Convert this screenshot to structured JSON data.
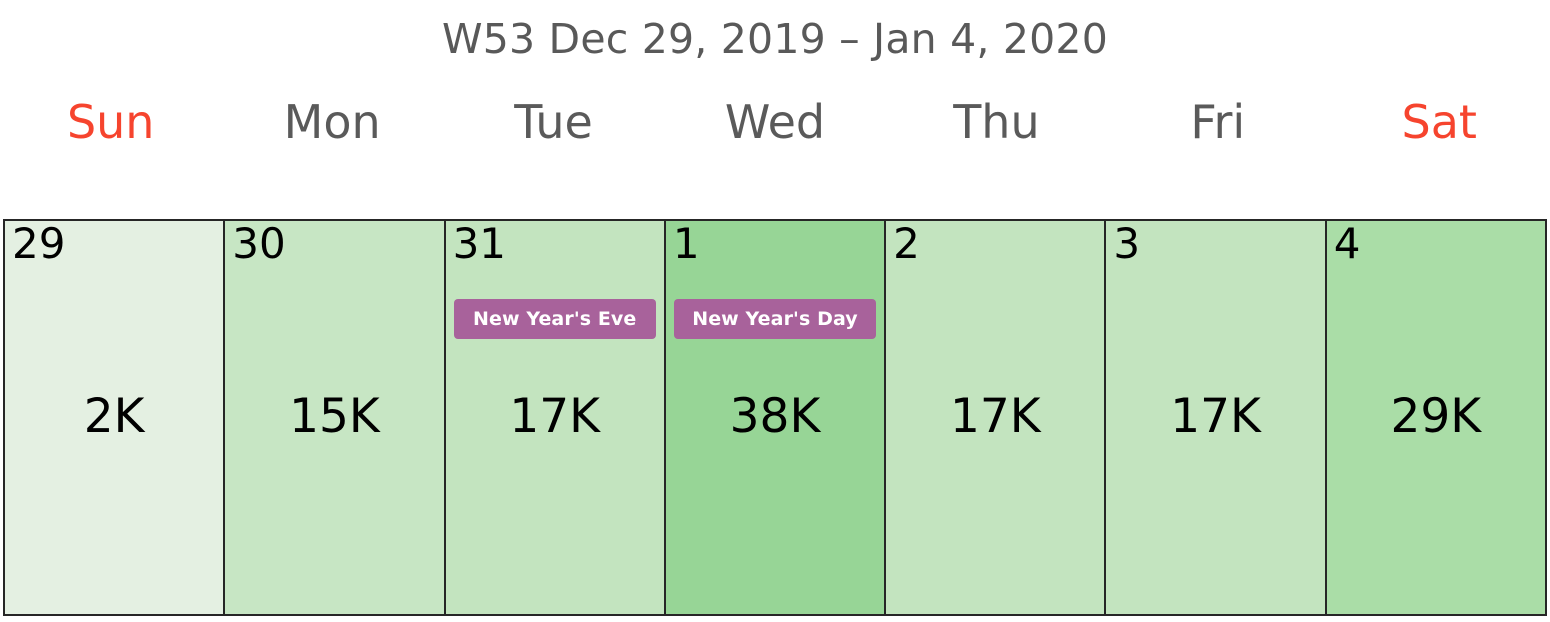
{
  "header": {
    "title": "W53 Dec 29, 2019 – Jan 4, 2020",
    "title_color": "#595959"
  },
  "weekdays": [
    {
      "label": "Sun",
      "weekend": true
    },
    {
      "label": "Mon",
      "weekend": false
    },
    {
      "label": "Tue",
      "weekend": false
    },
    {
      "label": "Wed",
      "weekend": false
    },
    {
      "label": "Thu",
      "weekend": false
    },
    {
      "label": "Fri",
      "weekend": false
    },
    {
      "label": "Sat",
      "weekend": true
    }
  ],
  "colors": {
    "weekend_text": "#f6442e",
    "weekday_text": "#5a5a5a",
    "grid_border": "#262626",
    "event_badge_bg": "#a8629b",
    "event_badge_text": "#ffffff",
    "value_text": "#000000"
  },
  "days": [
    {
      "day_number": "29",
      "value_label": "2K",
      "value": 2000,
      "cell_color": "#e4f0e2",
      "event": null
    },
    {
      "day_number": "30",
      "value_label": "15K",
      "value": 15000,
      "cell_color": "#c7e6c4",
      "event": null
    },
    {
      "day_number": "31",
      "value_label": "17K",
      "value": 17000,
      "cell_color": "#c3e4bf",
      "event": "New Year's Eve"
    },
    {
      "day_number": "1",
      "value_label": "38K",
      "value": 38000,
      "cell_color": "#97d596",
      "event": "New Year's Day"
    },
    {
      "day_number": "2",
      "value_label": "17K",
      "value": 17000,
      "cell_color": "#c3e4bf",
      "event": null
    },
    {
      "day_number": "3",
      "value_label": "17K",
      "value": 17000,
      "cell_color": "#c3e4bf",
      "event": null
    },
    {
      "day_number": "4",
      "value_label": "29K",
      "value": 29000,
      "cell_color": "#aadda7",
      "event": null
    }
  ],
  "chart_data": {
    "type": "heatmap",
    "title": "W53 Dec 29, 2019 – Jan 4, 2020",
    "categories": [
      "Sun 29",
      "Mon 30",
      "Tue 31",
      "Wed 1",
      "Thu 2",
      "Fri 3",
      "Sat 4"
    ],
    "values": [
      2000,
      15000,
      17000,
      38000,
      17000,
      17000,
      29000
    ],
    "value_labels": [
      "2K",
      "15K",
      "17K",
      "38K",
      "17K",
      "17K",
      "29K"
    ],
    "annotations": [
      {
        "category": "Tue 31",
        "text": "New Year's Eve"
      },
      {
        "category": "Wed 1",
        "text": "New Year's Day"
      }
    ],
    "xlabel": "",
    "ylabel": "",
    "grid": true,
    "legend": "none",
    "colorscale": [
      "#e4f0e2",
      "#97d596"
    ]
  }
}
